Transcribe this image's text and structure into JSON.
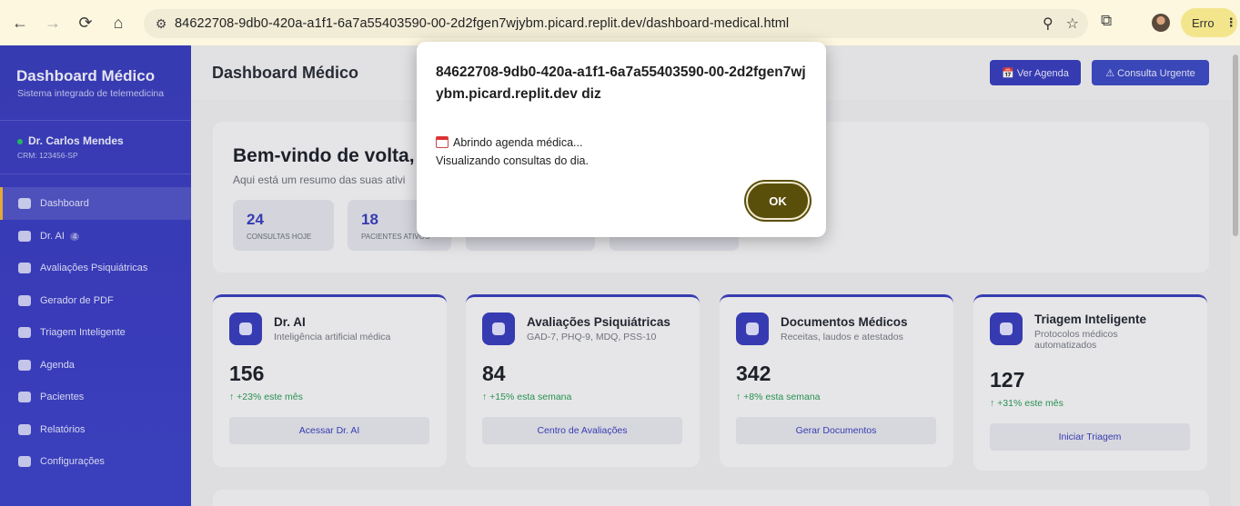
{
  "browser": {
    "url": "84622708-9db0-420a-a1f1-6a7a55403590-00-2d2fgen7wjybm.picard.replit.dev/dashboard-medical.html",
    "back_icon": "←",
    "forward_icon": "→",
    "reload_icon": "⟳",
    "home_icon": "⌂",
    "site_info_icon": "⚙",
    "zoom_icon": "⚲",
    "star_icon": "☆",
    "extensions_icon": "⧉",
    "error_label": "Erro",
    "menu_icon": "⋮"
  },
  "sidebar": {
    "title": "Dashboard Médico",
    "subtitle": "Sistema integrado de telemedicina",
    "user_name": "Dr. Carlos Mendes",
    "user_crm": "CRM: 123456-SP",
    "items": [
      {
        "label": "Dashboard",
        "icon": "chart-pie-icon"
      },
      {
        "label": "Dr. AI",
        "icon": "robot-icon",
        "badge": "4"
      },
      {
        "label": "Avaliações Psiquiátricas",
        "icon": "brain-icon"
      },
      {
        "label": "Gerador de PDF",
        "icon": "pdf-file-icon"
      },
      {
        "label": "Triagem Inteligente",
        "icon": "stethoscope-icon"
      },
      {
        "label": "Agenda",
        "icon": "calendar-icon"
      },
      {
        "label": "Pacientes",
        "icon": "users-icon"
      },
      {
        "label": "Relatórios",
        "icon": "line-chart-icon"
      },
      {
        "label": "Configurações",
        "icon": "gear-icon"
      }
    ]
  },
  "header": {
    "title": "Dashboard Médico",
    "agenda_button": "📅 Ver Agenda",
    "urgent_button": "⚠ Consulta Urgente"
  },
  "welcome": {
    "title": "Bem-vindo de volta,",
    "subtitle": "Aqui está um resumo das suas ativi",
    "stats": [
      {
        "value": "24",
        "label": "CONSULTAS HOJE"
      },
      {
        "value": "18",
        "label": "PACIENTES ATIVOS"
      }
    ]
  },
  "cards": [
    {
      "title": "Dr. AI",
      "subtitle": "Inteligência artificial médica",
      "value": "156",
      "growth": "↑ +23% este mês",
      "button": "Acessar Dr. AI",
      "icon": "robot-icon"
    },
    {
      "title": "Avaliações Psiquiátricas",
      "subtitle": "GAD-7, PHQ-9, MDQ, PSS-10",
      "value": "84",
      "growth": "↑ +15% esta semana",
      "button": "Centro de Avaliações",
      "icon": "brain-icon"
    },
    {
      "title": "Documentos Médicos",
      "subtitle": "Receitas, laudos e atestados",
      "value": "342",
      "growth": "↑ +8% esta semana",
      "button": "Gerar Documentos",
      "icon": "document-icon"
    },
    {
      "title": "Triagem Inteligente",
      "subtitle": "Protocolos médicos automatizados",
      "value": "127",
      "growth": "↑ +31% este mês",
      "button": "Iniciar Triagem",
      "icon": "stethoscope-icon"
    }
  ],
  "dialog": {
    "origin": "84622708-9db0-420a-a1f1-6a7a55403590-00-2d2fgen7wjybm.picard.replit.dev diz",
    "line1": "Abrindo agenda médica...",
    "line2": "Visualizando consultas do dia.",
    "ok": "OK"
  }
}
